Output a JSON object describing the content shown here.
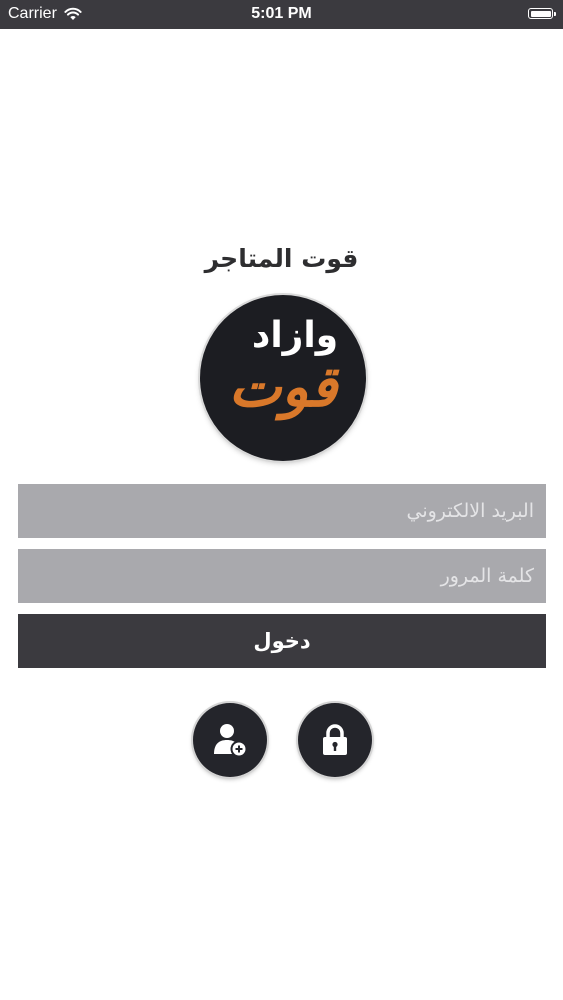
{
  "status_bar": {
    "carrier": "Carrier",
    "time": "5:01 PM"
  },
  "store": {
    "title": "قوت المتاجر",
    "logo_line1": "وازاد",
    "logo_line2": "قوت",
    "logo_colors": {
      "background": "#1c1d22",
      "line1": "#ffffff",
      "line2": "#d9782a"
    }
  },
  "login_form": {
    "email_placeholder": "البريد الالكتروني",
    "password_placeholder": "كلمة المرور",
    "login_label": "دخول"
  },
  "actions": {
    "register_icon": "add-user-icon",
    "forgot_password_icon": "lock-icon"
  },
  "colors": {
    "accent_dark": "#3b3a3f",
    "field_bg": "#a9a9ad"
  }
}
